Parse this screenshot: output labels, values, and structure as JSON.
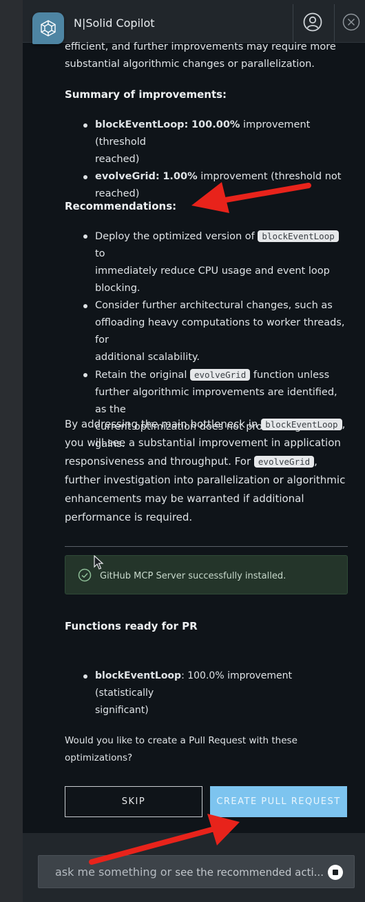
{
  "header": {
    "title": "N|Solid Copilot",
    "logo_icon": "cube-icon",
    "user_icon": "user-circle-icon",
    "close_icon": "close-circle-icon"
  },
  "message": {
    "intro_line1": "efficient, and further improvements may require more",
    "intro_line2": "substantial algorithmic changes or parallelization.",
    "summary_heading": "Summary of improvements:",
    "summary_items": [
      {
        "name": "blockEventLoop:",
        "value": "100.00%",
        "text1": " improvement (threshold",
        "text2": "reached)"
      },
      {
        "name": "evolveGrid:",
        "value": "1.00%",
        "text1": " improvement (threshold not",
        "text2": "reached)"
      }
    ],
    "recommendations_heading": "Recommendations:",
    "rec1": {
      "a": "Deploy the optimized version of",
      "code": "blockEventLoop",
      "b": "to",
      "line2": "immediately reduce CPU usage and event loop",
      "line3": "blocking."
    },
    "rec2": {
      "line1": "Consider further architectural changes, such as",
      "line2": "offloading heavy computations to worker threads, for",
      "line3": "additional scalability."
    },
    "rec3": {
      "a": "Retain the original",
      "code": "evolveGrid",
      "b": "function unless",
      "line2": "further algorithmic improvements are identified, as the",
      "line3": "current optimization does not provide significant",
      "line4": "gains."
    },
    "closing": {
      "l1a": "By addressing the main bottleneck in",
      "l1code": "blockEventLoop",
      "l1b": ",",
      "l2": "you will see a substantial improvement in application",
      "l3a": "responsiveness and throughput. For",
      "l3code": "evolveGrid",
      "l3b": ",",
      "l4": "further investigation into parallelization or algorithmic",
      "l5": "enhancements may be warranted if additional",
      "l6": "performance is required."
    }
  },
  "alert": {
    "icon": "check-circle-icon",
    "text": "GitHub MCP Server successfully installed."
  },
  "pr": {
    "heading": "Functions ready for PR",
    "item_name": "blockEventLoop",
    "item_text1": ": 100.0% improvement (statistically",
    "item_text2": "significant)",
    "question_line1": "Would you like to create a Pull Request with these",
    "question_line2": "optimizations?",
    "skip_label": "SKIP",
    "create_label": "CREATE PULL REQUEST"
  },
  "input": {
    "typed": "ask me something or",
    "placeholder": "see the recommended acti...",
    "stop_icon": "stop-icon"
  },
  "colors": {
    "panel_bg": "#0f1419",
    "header_bg": "#21262b",
    "accent_blue": "#7dc4ef",
    "logo_blue": "#4e85a3",
    "success_bg": "#24352a",
    "annotation_red": "#e8231b"
  }
}
